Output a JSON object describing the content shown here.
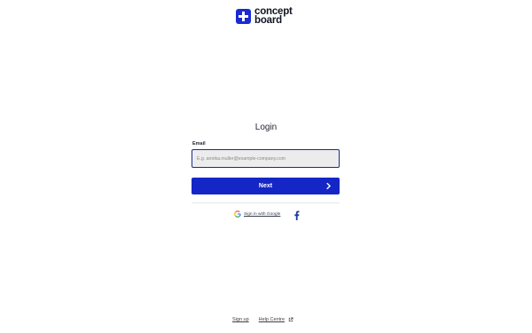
{
  "brand": {
    "name_line1": "concept",
    "name_line2": "board",
    "accent": "#1426c6"
  },
  "login": {
    "title": "Login",
    "email_label": "Email",
    "email_placeholder": "E.g. annika.muller@example-company.com",
    "email_value": "",
    "next_label": "Next"
  },
  "social": {
    "google_label": "Sign in with Google",
    "facebook_icon": "facebook-icon"
  },
  "footer": {
    "signup_label": "Sign up",
    "help_label": "Help Centre"
  }
}
